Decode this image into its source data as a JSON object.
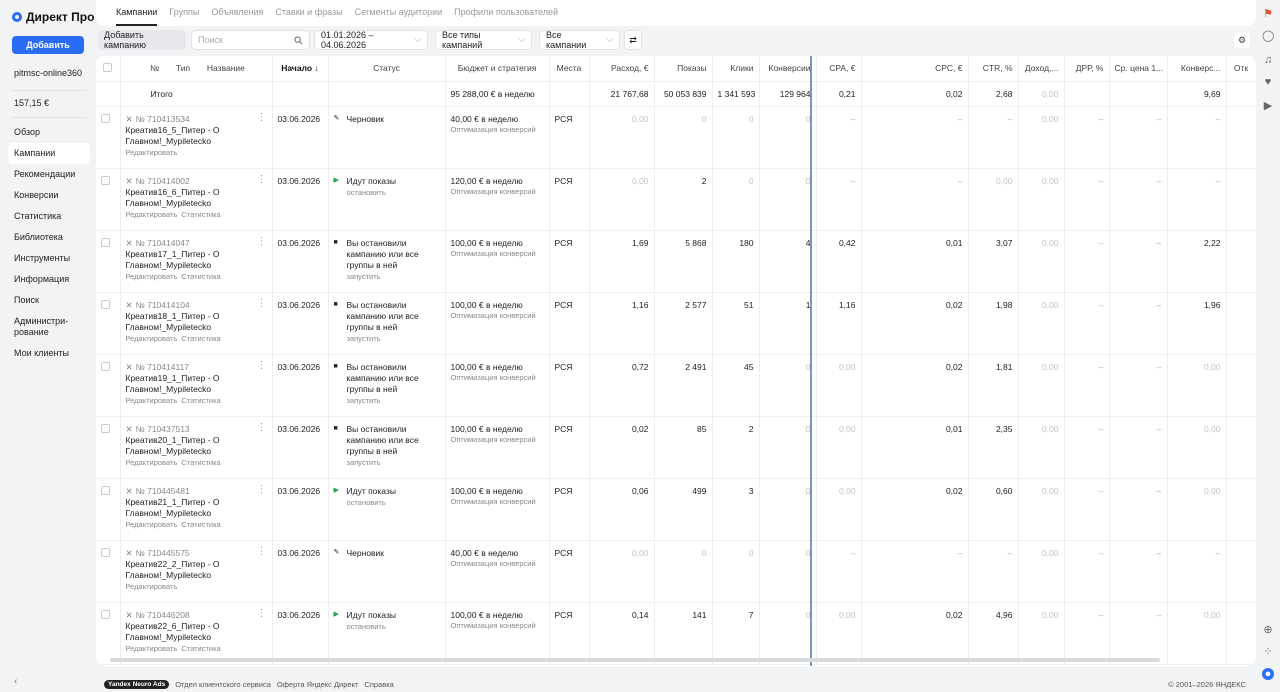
{
  "app": {
    "logo_text": "Директ Про"
  },
  "sidebar": {
    "add_label": "Добавить",
    "account": "pitmsc-online360",
    "balance": "157,15 €",
    "items": [
      {
        "label": "Обзор"
      },
      {
        "label": "Кампании"
      },
      {
        "label": "Рекомендации"
      },
      {
        "label": "Конверсии"
      },
      {
        "label": "Статистика"
      },
      {
        "label": "Библиотека"
      },
      {
        "label": "Инструменты"
      },
      {
        "label": "Информация"
      },
      {
        "label": "Поиск"
      },
      {
        "label": "Администри-рование"
      },
      {
        "label": "Мои клиенты"
      }
    ],
    "active_item": "Кампании",
    "collapse_glyph": "‹"
  },
  "tabs": [
    "Кампании",
    "Группы",
    "Объявления",
    "Ставки и фразы",
    "Сегменты аудитории",
    "Профили пользователей"
  ],
  "toolbar": {
    "add_campaign": "Добавить кампанию",
    "search_placeholder": "Поиск",
    "date_range": "01.01.2026 – 04.06.2026",
    "campaign_types": "Все типы кампаний",
    "campaigns_filter": "Все кампании"
  },
  "columns": {
    "num": "№",
    "type": "Тип",
    "name": "Название",
    "start": "Начало ↓",
    "status": "Статус",
    "budget": "Бюджет и стратегия",
    "places": "Места",
    "spend": "Расход, €",
    "impressions": "Показы",
    "clicks": "Клики",
    "conversions": "Конверсии",
    "cpa": "CPA, €",
    "cpc": "CPC, €",
    "ctr": "CTR, %",
    "income": "Доход,...",
    "drr": "ДРР, %",
    "avg_price": "Ср. цена 1...",
    "conv_rate": "Конверс...",
    "extra": "Отк"
  },
  "totals": {
    "label": "Итого",
    "budget": "95 288,00 € в неделю",
    "spend": "21 767,68",
    "impressions": "50 053 839",
    "clicks": "1 341 593",
    "conversions": "129 964",
    "cpa": "0,21",
    "cpc": "0,02",
    "ctr": "2,68",
    "income": "0,00",
    "conv_rate": "9,69"
  },
  "row_links": {
    "edit": "Редактировать",
    "stats": "Статистика"
  },
  "campaigns": [
    {
      "id": "№ 710413534",
      "name": "Креатив16_5_Питер - О Главном!_Mypiletecko",
      "has_stats": false,
      "start": "03.06.2026",
      "status_kind": "draft",
      "status": "Черновик",
      "status_action": "",
      "budget": "40,00 € в неделю",
      "strategy": "Оптимизация конверсий",
      "places": "РСЯ",
      "spend": "0,00",
      "impressions": "0",
      "clicks": "0",
      "conversions": "0",
      "cpa": "–",
      "cpc": "–",
      "ctr": "–",
      "income": "0,00",
      "drr": "–",
      "avg_price": "–",
      "conv_rate": "–"
    },
    {
      "id": "№ 710414002",
      "name": "Креатив16_6_Питер - О Главном!_Mypiletecko",
      "has_stats": true,
      "start": "03.06.2026",
      "status_kind": "play",
      "status": "Идут показы",
      "status_action": "остановить",
      "budget": "120,00 € в неделю",
      "strategy": "Оптимизация конверсий",
      "places": "РСЯ",
      "spend": "0,00",
      "impressions": "2",
      "clicks": "0",
      "conversions": "0",
      "cpa": "–",
      "cpc": "–",
      "ctr": "0,00",
      "income": "0,00",
      "drr": "–",
      "avg_price": "–",
      "conv_rate": "–"
    },
    {
      "id": "№ 710414047",
      "name": "Креатив17_1_Питер - О Главном!_Mypiletecko",
      "has_stats": true,
      "start": "03.06.2026",
      "status_kind": "stop",
      "status": "Вы остановили кампанию или все группы в ней",
      "status_action": "запустить",
      "budget": "100,00 € в неделю",
      "strategy": "Оптимизация конверсий",
      "places": "РСЯ",
      "spend": "1,69",
      "impressions": "5 868",
      "clicks": "180",
      "conversions": "4",
      "cpa": "0,42",
      "cpc": "0,01",
      "ctr": "3,07",
      "income": "0,00",
      "drr": "–",
      "avg_price": "–",
      "conv_rate": "2,22"
    },
    {
      "id": "№ 710414104",
      "name": "Креатив18_1_Питер - О Главном!_Mypiletecko",
      "has_stats": true,
      "start": "03.06.2026",
      "status_kind": "stop",
      "status": "Вы остановили кампанию или все группы в ней",
      "status_action": "запустить",
      "budget": "100,00 € в неделю",
      "strategy": "Оптимизация конверсий",
      "places": "РСЯ",
      "spend": "1,16",
      "impressions": "2 577",
      "clicks": "51",
      "conversions": "1",
      "cpa": "1,16",
      "cpc": "0,02",
      "ctr": "1,98",
      "income": "0,00",
      "drr": "–",
      "avg_price": "–",
      "conv_rate": "1,96"
    },
    {
      "id": "№ 710414117",
      "name": "Креатив19_1_Питер - О Главном!_Mypiletecko",
      "has_stats": true,
      "start": "03.06.2026",
      "status_kind": "stop",
      "status": "Вы остановили кампанию или все группы в ней",
      "status_action": "запустить",
      "budget": "100,00 € в неделю",
      "strategy": "Оптимизация конверсий",
      "places": "РСЯ",
      "spend": "0,72",
      "impressions": "2 491",
      "clicks": "45",
      "conversions": "0",
      "cpa": "0,00",
      "cpc": "0,02",
      "ctr": "1,81",
      "income": "0,00",
      "drr": "–",
      "avg_price": "–",
      "conv_rate": "0,00"
    },
    {
      "id": "№ 710437513",
      "name": "Креатив20_1_Питер - О Главном!_Mypiletecko",
      "has_stats": true,
      "start": "03.06.2026",
      "status_kind": "stop",
      "status": "Вы остановили кампанию или все группы в ней",
      "status_action": "запустить",
      "budget": "100,00 € в неделю",
      "strategy": "Оптимизация конверсий",
      "places": "РСЯ",
      "spend": "0,02",
      "impressions": "85",
      "clicks": "2",
      "conversions": "0",
      "cpa": "0,00",
      "cpc": "0,01",
      "ctr": "2,35",
      "income": "0,00",
      "drr": "–",
      "avg_price": "–",
      "conv_rate": "0,00"
    },
    {
      "id": "№ 710445481",
      "name": "Креатив21_1_Питер - О Главном!_Mypiletecko",
      "has_stats": true,
      "start": "03.06.2026",
      "status_kind": "play",
      "status": "Идут показы",
      "status_action": "остановить",
      "budget": "100,00 € в неделю",
      "strategy": "Оптимизация конверсий",
      "places": "РСЯ",
      "spend": "0,06",
      "impressions": "499",
      "clicks": "3",
      "conversions": "0",
      "cpa": "0,00",
      "cpc": "0,02",
      "ctr": "0,60",
      "income": "0,00",
      "drr": "–",
      "avg_price": "–",
      "conv_rate": "0,00"
    },
    {
      "id": "№ 710445575",
      "name": "Креатив22_2_Питер - О Главном!_Mypiletecko",
      "has_stats": false,
      "start": "03.06.2026",
      "status_kind": "draft",
      "status": "Черновик",
      "status_action": "",
      "budget": "40,00 € в неделю",
      "strategy": "Оптимизация конверсий",
      "places": "РСЯ",
      "spend": "0,00",
      "impressions": "0",
      "clicks": "0",
      "conversions": "0",
      "cpa": "–",
      "cpc": "–",
      "ctr": "–",
      "income": "0,00",
      "drr": "–",
      "avg_price": "–",
      "conv_rate": "–"
    },
    {
      "id": "№ 710446208",
      "name": "Креатив22_6_Питер - О Главном!_Mypiletecko",
      "has_stats": true,
      "start": "03.06.2026",
      "status_kind": "play",
      "status": "Идут показы",
      "status_action": "остановить",
      "budget": "100,00 € в неделю",
      "strategy": "Оптимизация конверсий",
      "places": "РСЯ",
      "spend": "0,14",
      "impressions": "141",
      "clicks": "7",
      "conversions": "0",
      "cpa": "0,00",
      "cpc": "0,02",
      "ctr": "4,96",
      "income": "0,00",
      "drr": "–",
      "avg_price": "–",
      "conv_rate": "0,00"
    }
  ],
  "footer": {
    "neuro": "Yandex Neuro Ads",
    "client_service": "Отдел клиентского сервиса",
    "offer": "Оферта Яндекс Директ",
    "help": "Справка",
    "copyright": "© 2001–2026 ЯНДЕКС"
  },
  "colors": {
    "accent": "#2b6cf6",
    "active_status": "#1aa54a"
  }
}
